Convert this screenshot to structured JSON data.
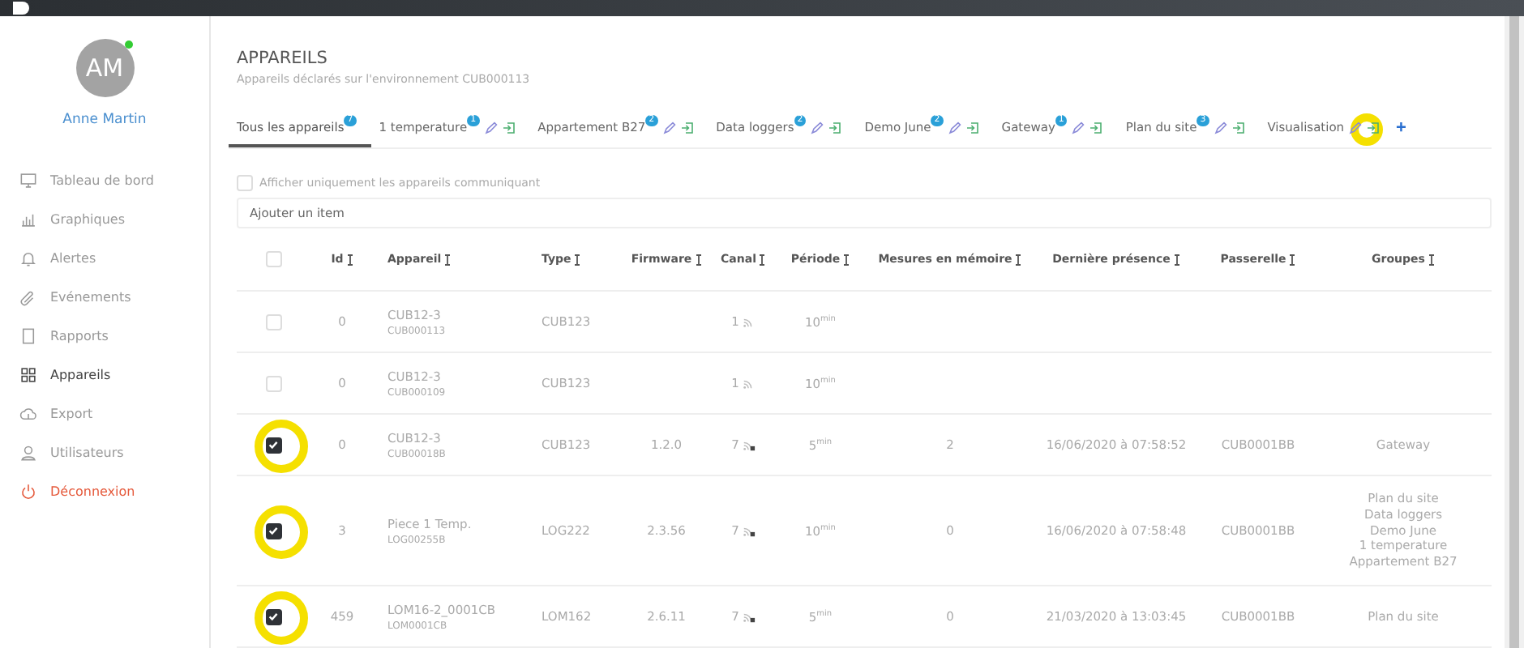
{
  "user": {
    "initials": "AM",
    "name": "Anne Martin",
    "online": true
  },
  "sidebar": {
    "items": [
      {
        "label": "Tableau de bord",
        "kind": "nav",
        "selected": false
      },
      {
        "label": "Graphiques",
        "kind": "nav",
        "selected": false
      },
      {
        "label": "Alertes",
        "kind": "nav",
        "selected": false
      },
      {
        "label": "Evénements",
        "kind": "nav",
        "selected": false
      },
      {
        "label": "Rapports",
        "kind": "nav",
        "selected": false
      },
      {
        "label": "Appareils",
        "kind": "nav",
        "selected": true
      },
      {
        "label": "Export",
        "kind": "nav",
        "selected": false
      },
      {
        "label": "Utilisateurs",
        "kind": "nav",
        "selected": false
      },
      {
        "label": "Déconnexion",
        "kind": "logout",
        "selected": false
      }
    ]
  },
  "page": {
    "title": "APPAREILS",
    "subtitle": "Appareils déclarés sur l'environnement CUB000113"
  },
  "tabs": [
    {
      "label": "Tous les appareils",
      "count": "7",
      "editable": false,
      "selected": true,
      "highlighted": false
    },
    {
      "label": "1 temperature",
      "count": "1",
      "editable": true,
      "selected": false,
      "highlighted": false
    },
    {
      "label": "Appartement B27",
      "count": "2",
      "editable": true,
      "selected": false,
      "highlighted": false
    },
    {
      "label": "Data loggers",
      "count": "2",
      "editable": true,
      "selected": false,
      "highlighted": false
    },
    {
      "label": "Demo June",
      "count": "2",
      "editable": true,
      "selected": false,
      "highlighted": false
    },
    {
      "label": "Gateway",
      "count": "1",
      "editable": true,
      "selected": false,
      "highlighted": false
    },
    {
      "label": "Plan du site",
      "count": "3",
      "editable": true,
      "selected": false,
      "highlighted": false
    },
    {
      "label": "Visualisation",
      "editable": true,
      "selected": false,
      "highlighted": true
    }
  ],
  "add_tab": "+",
  "filter": {
    "label": "Afficher uniquement les appareils communiquant",
    "checked": false
  },
  "search": {
    "placeholder": "Ajouter un item"
  },
  "table": {
    "select_all": {
      "checked": false
    },
    "columns": [
      "Id",
      "Appareil",
      "Type",
      "Firmware",
      "Canal",
      "Période",
      "Mesures en mémoire",
      "Dernière présence",
      "Passerelle",
      "Groupes"
    ],
    "rows": [
      {
        "checked": false,
        "highlighted": false,
        "id": "0",
        "name": "CUB12-3",
        "serial": "CUB000113",
        "type": "CUB123",
        "canal": "1",
        "canal_lock": false,
        "period": "10$^{min}$"
      },
      {
        "checked": false,
        "highlighted": false,
        "id": "0",
        "name": "CUB12-3",
        "serial": "CUB000109",
        "type": "CUB123",
        "canal": "1",
        "canal_lock": false,
        "period": "10$^{min}$"
      },
      {
        "checked": true,
        "highlighted": true,
        "id": "0",
        "name": "CUB12-3",
        "serial": "CUB00018B",
        "type": "CUB123",
        "firmware": "1.2.0",
        "canal": "7",
        "canal_lock": true,
        "period": "5$^{min}$",
        "measures": "2",
        "last_seen": "16/06/2020 à 07:58:52",
        "gateway": "CUB0001BB",
        "groups": [
          "Gateway"
        ]
      },
      {
        "checked": true,
        "highlighted": true,
        "id": "3",
        "name": "Piece 1 Temp.",
        "serial": "LOG00255B",
        "type": "LOG222",
        "firmware": "2.3.56",
        "canal": "7",
        "canal_lock": true,
        "period": "10$^{min}$",
        "measures": "0",
        "last_seen": "16/06/2020 à 07:58:48",
        "gateway": "CUB0001BB",
        "groups": [
          "Plan du site",
          "Data loggers",
          "Demo June",
          "1 temperature",
          "Appartement B27"
        ]
      },
      {
        "checked": true,
        "highlighted": true,
        "id": "459",
        "name": "LOM16-2_0001CB",
        "serial": "LOM0001CB",
        "type": "LOM162",
        "firmware": "2.6.11",
        "canal": "7",
        "canal_lock": true,
        "period": "5$^{min}$",
        "measures": "0",
        "last_seen": "21/03/2020 à 13:03:45",
        "gateway": "CUB0001BB",
        "groups": [
          "Plan du site"
        ]
      }
    ]
  }
}
